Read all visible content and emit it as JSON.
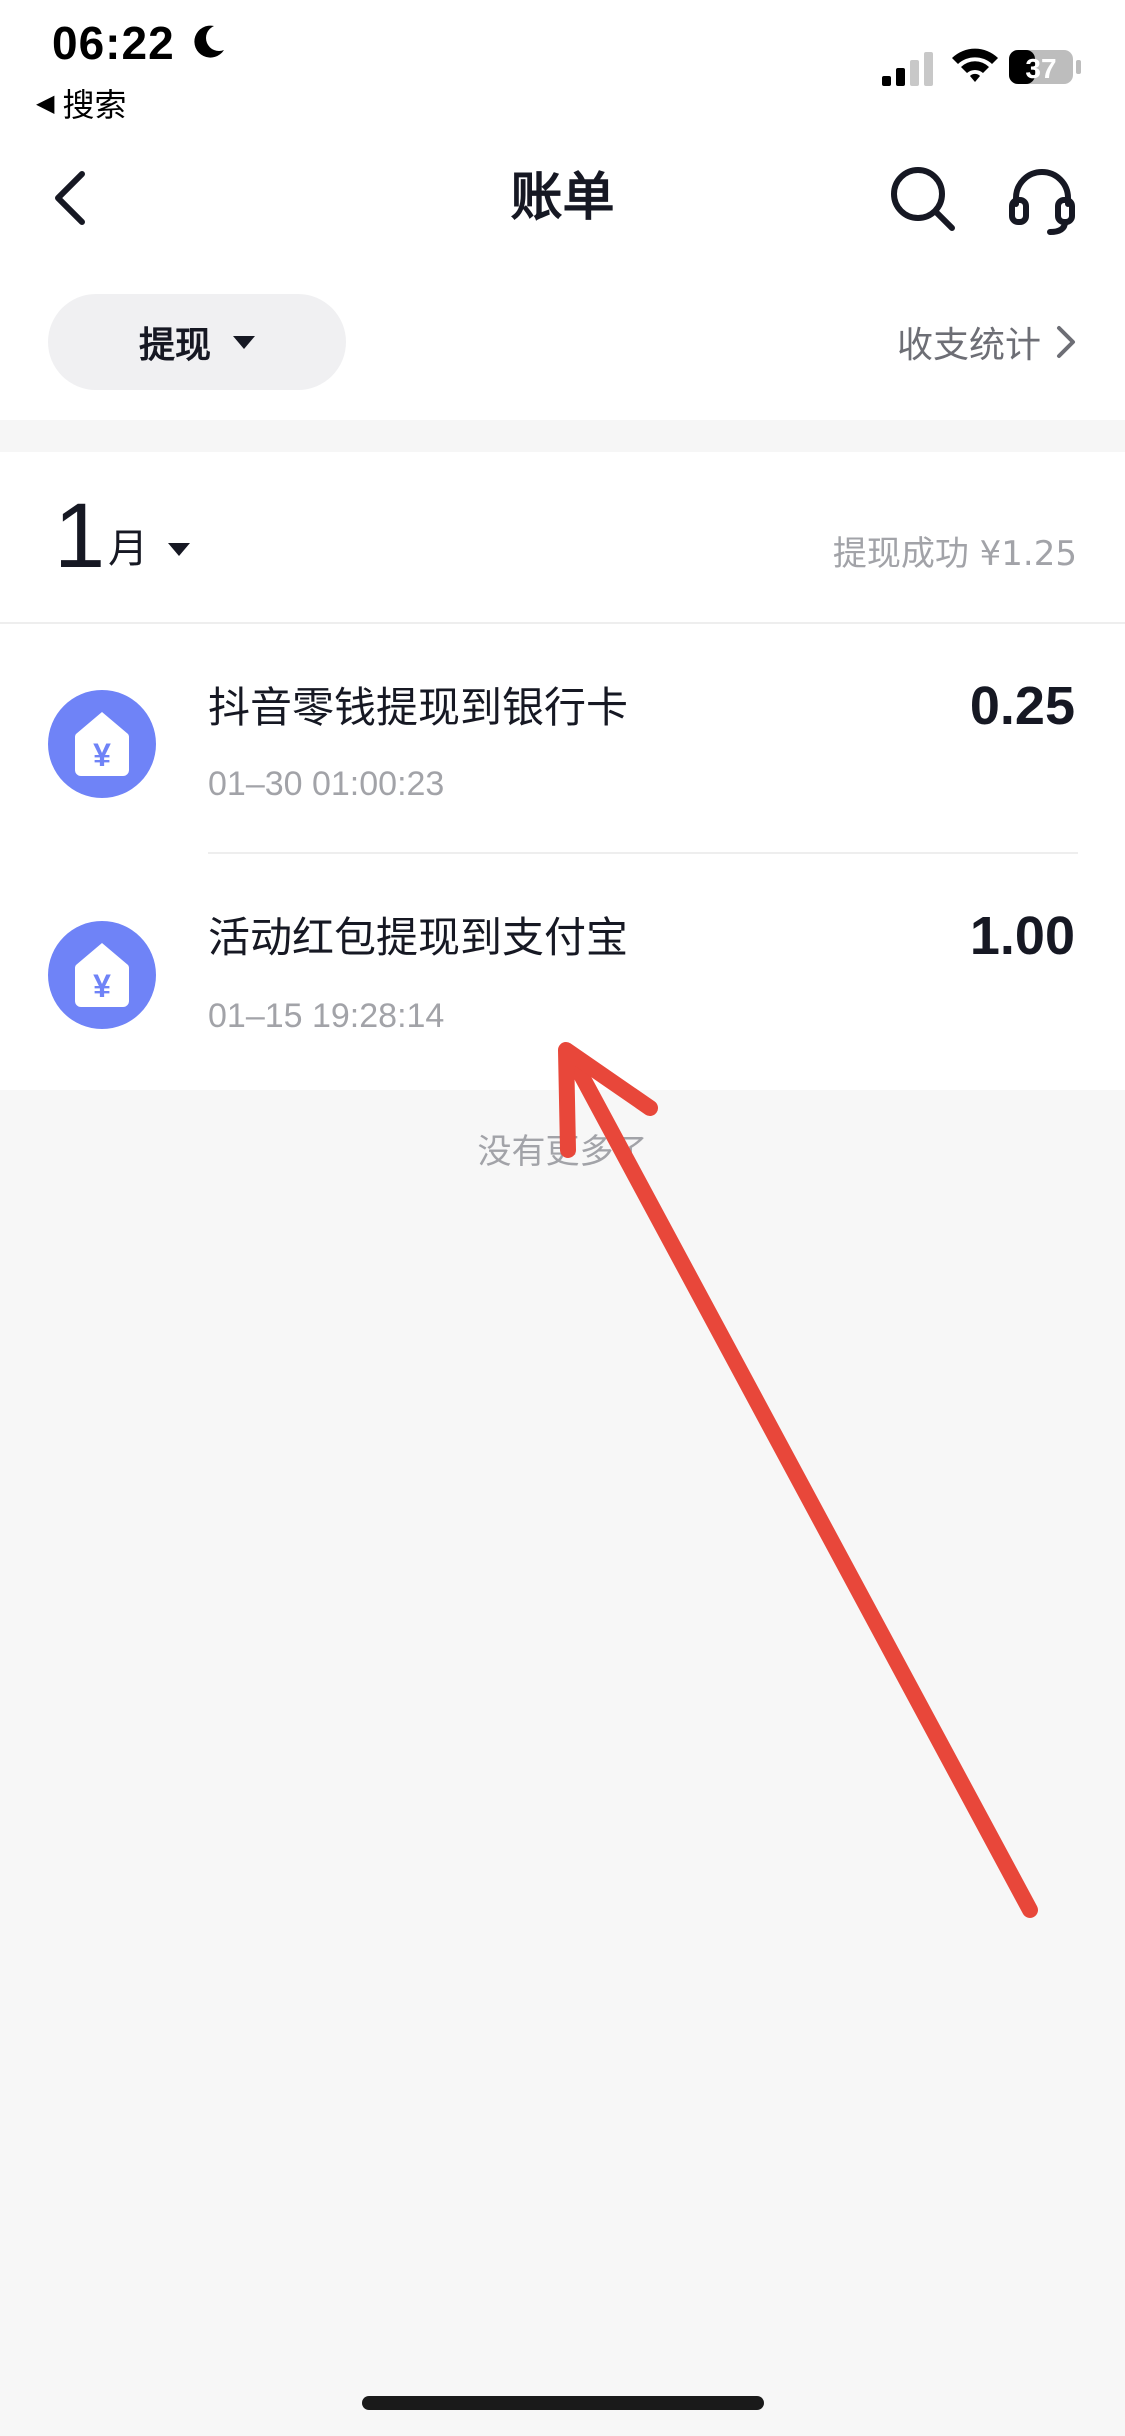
{
  "status_bar": {
    "time": "06:22",
    "back_app_label": "搜索",
    "battery": "37"
  },
  "header": {
    "title": "账单"
  },
  "filter": {
    "selected": "提现",
    "stats_label": "收支统计"
  },
  "month_section": {
    "month_number": "1",
    "month_suffix": "月",
    "summary": "提现成功 ¥1.25"
  },
  "transactions": [
    {
      "title": "抖音零钱提现到银行卡",
      "time": "01–30 01:00:23",
      "amount": "0.25"
    },
    {
      "title": "活动红包提现到支付宝",
      "time": "01–15 19:28:14",
      "amount": "1.00"
    }
  ],
  "footer": {
    "no_more": "没有更多了"
  },
  "colors": {
    "accent_icon": "#6f83f7",
    "annotation_arrow": "#e8473a"
  },
  "icons": {
    "back": "chevron-left-icon",
    "search": "search-icon",
    "support": "headset-icon",
    "transaction": "yuan-house-icon"
  }
}
